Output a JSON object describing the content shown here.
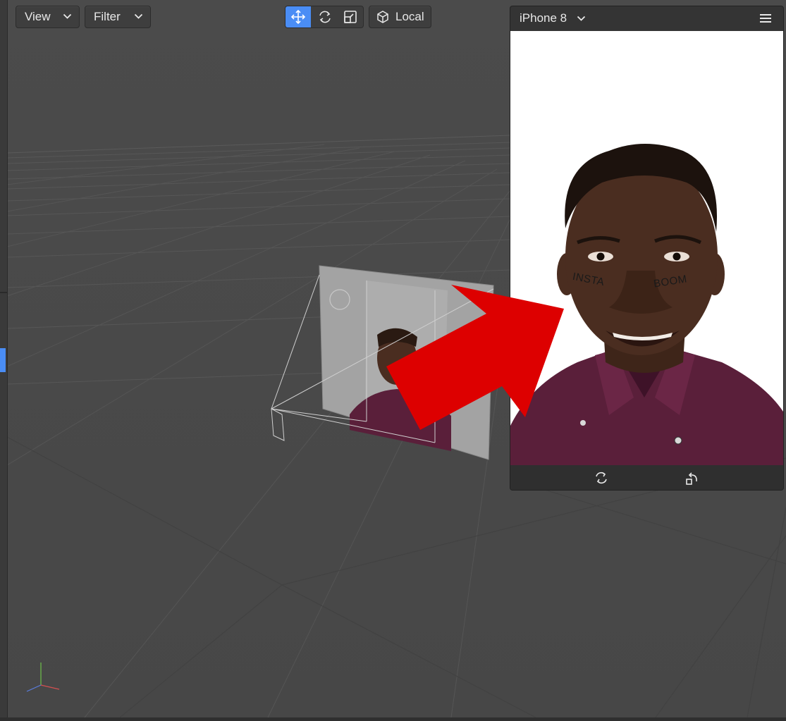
{
  "toolbar": {
    "view_label": "View",
    "filter_label": "Filter",
    "local_label": "Local",
    "tools": [
      {
        "name": "move",
        "icon": "move-arrows-icon",
        "active": true
      },
      {
        "name": "rotate",
        "icon": "rotate-icon",
        "active": false
      },
      {
        "name": "scale",
        "icon": "scale-icon",
        "active": false
      }
    ]
  },
  "preview": {
    "device": "iPhone 8",
    "menu_icon": "hamburger-menu-icon",
    "overlay_words": [
      "INSTA",
      "BOOM"
    ],
    "footer_icons": [
      "flip-camera-icon",
      "reset-rotate-icon"
    ]
  },
  "colors": {
    "accent": "#4a8df5",
    "viewport_bg": "#4b4b4b",
    "arrow": "#dd0000",
    "shirt": "#5a1f3a",
    "skin": "#4a2d20"
  }
}
